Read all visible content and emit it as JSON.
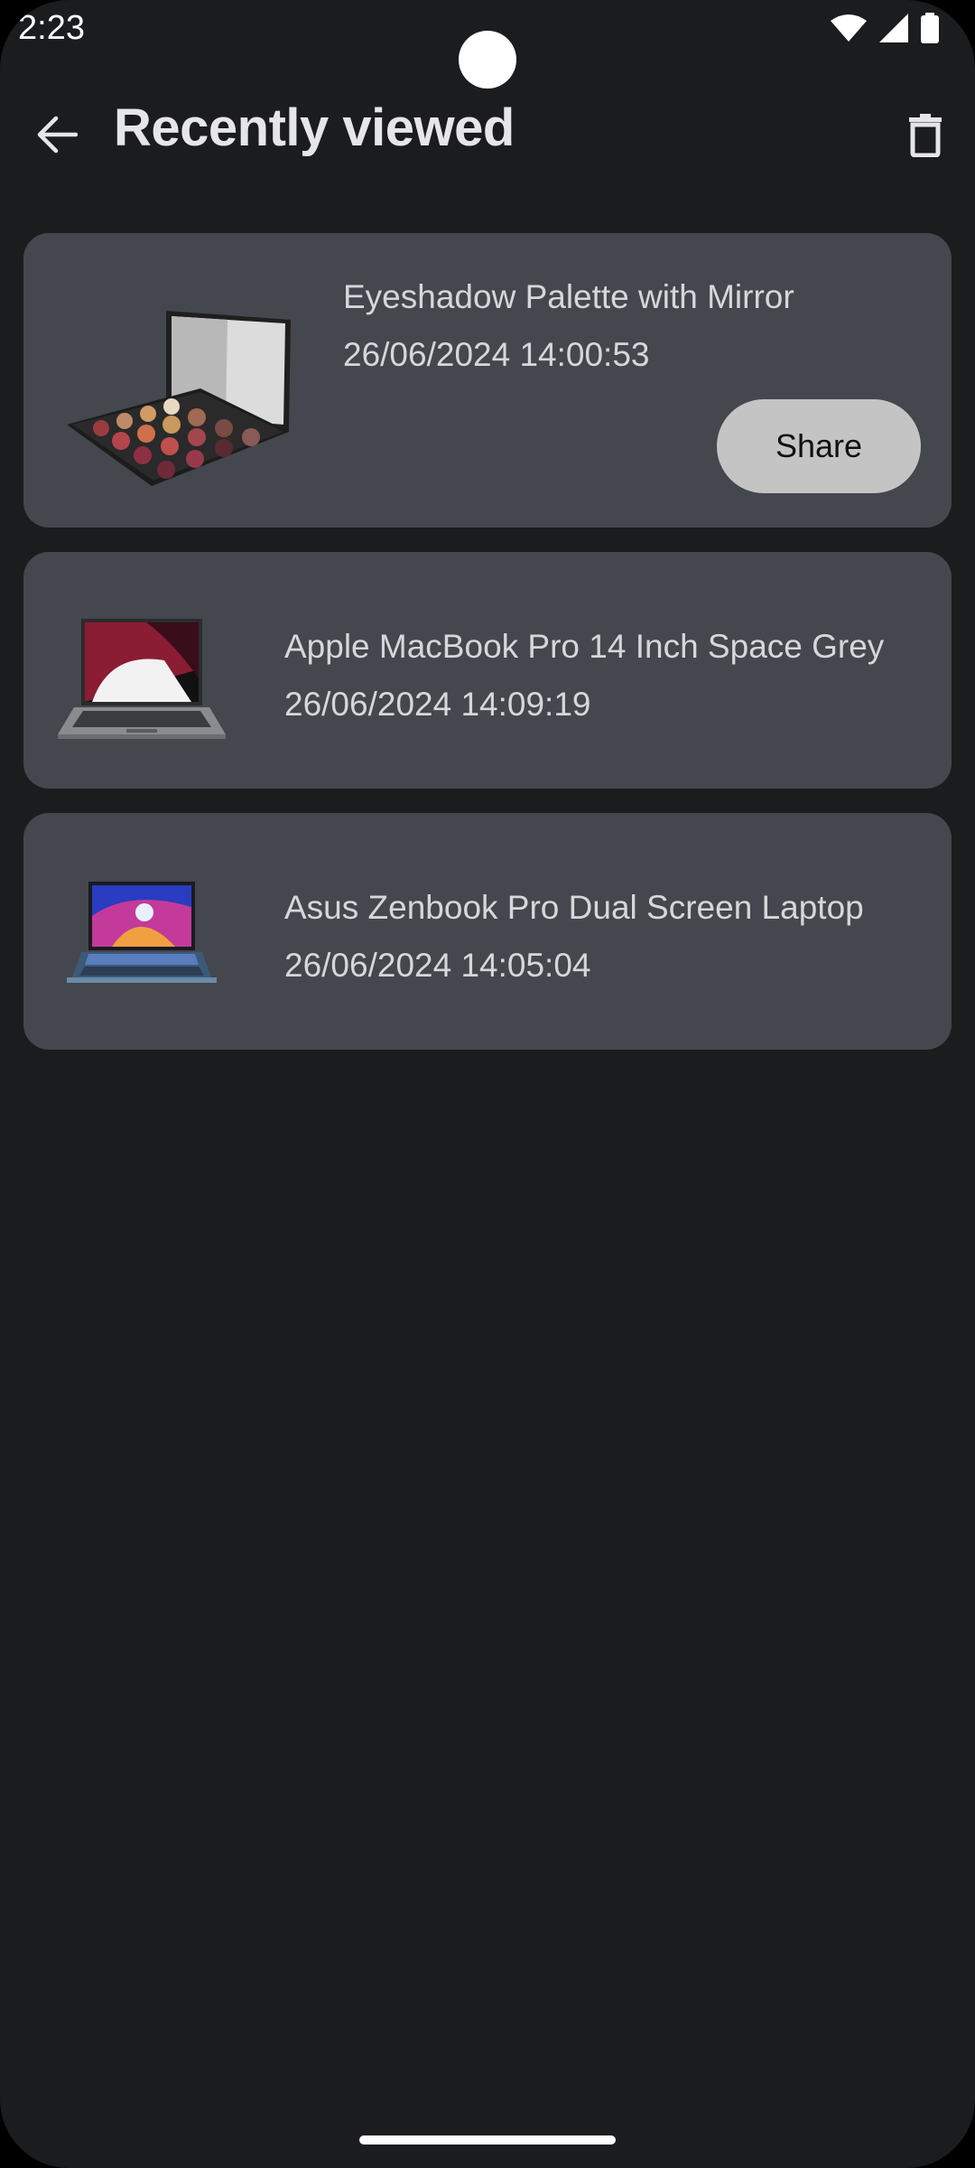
{
  "status_bar": {
    "time": "2:23"
  },
  "app_bar": {
    "title": "Recently viewed",
    "back_icon": "arrow-back-icon",
    "delete_icon": "trash-icon"
  },
  "items": [
    {
      "name": "Eyeshadow Palette with Mirror",
      "viewed_at": "26/06/2024 14:00:53",
      "share_label": "Share",
      "thumbnail": "eyeshadow-palette"
    },
    {
      "name": "Apple MacBook Pro 14 Inch Space Grey",
      "viewed_at": "26/06/2024 14:09:19",
      "thumbnail": "macbook-pro"
    },
    {
      "name": "Asus Zenbook Pro Dual Screen Laptop",
      "viewed_at": "26/06/2024 14:05:04",
      "thumbnail": "asus-zenbook"
    }
  ],
  "colors": {
    "background": "#1b1c1e",
    "card": "#44474d",
    "share_button": "#c4c4c4",
    "text": "#d6d7da"
  }
}
